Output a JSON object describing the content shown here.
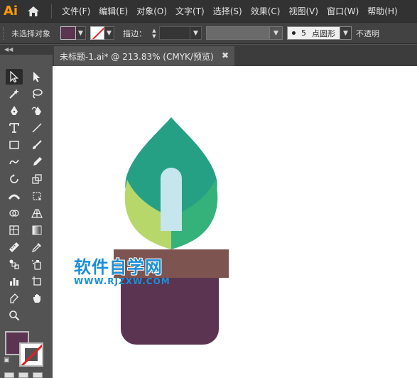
{
  "app": {
    "logo_text": "Ai"
  },
  "menu": {
    "items": [
      "文件(F)",
      "编辑(E)",
      "对象(O)",
      "文字(T)",
      "选择(S)",
      "效果(C)",
      "视图(V)",
      "窗口(W)",
      "帮助(H)"
    ]
  },
  "control_bar": {
    "selection_status": "未选择对象",
    "fill_color": "#5a3450",
    "stroke_label": "描边：",
    "brush_size": "5",
    "brush_name": "点圆形",
    "opacity_label": "不透明"
  },
  "document": {
    "tab_title": "未标题-1.ai* @ 213.83% (CMYK/预览)"
  },
  "tools": {
    "fill_color": "#5a3450",
    "stroke_color": "#ffffff",
    "items": [
      "selection-tool",
      "direct-selection-tool",
      "magic-wand-tool",
      "lasso-tool",
      "pen-tool",
      "curvature-tool",
      "type-tool",
      "line-segment-tool",
      "rectangle-tool",
      "paintbrush-tool",
      "shaper-tool",
      "pencil-tool",
      "rotate-tool",
      "scale-tool",
      "width-tool",
      "free-transform-tool",
      "shape-builder-tool",
      "perspective-grid-tool",
      "mesh-tool",
      "gradient-tool",
      "measure-tool",
      "eyedropper-tool",
      "blend-tool",
      "symbol-sprayer-tool",
      "column-graph-tool",
      "artboard-tool",
      "slice-tool",
      "hand-tool",
      "zoom-tool"
    ]
  },
  "artwork": {
    "leaf_top_color": "#26a085",
    "leaf_left_color": "#b8d76b",
    "leaf_right_color": "#35b27a",
    "stem_color": "#c5e6ec",
    "pot_rim_color": "#7d5450",
    "pot_body_color": "#5a3450"
  },
  "watermark": {
    "title": "软件自学网",
    "url": "WWW.RJZXW.COM"
  }
}
